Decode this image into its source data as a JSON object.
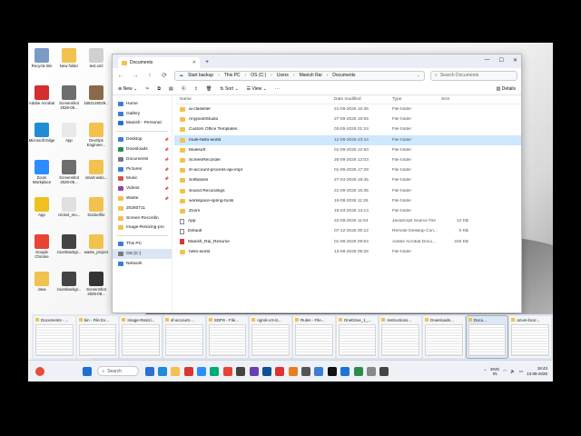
{
  "desktop": {
    "icons": [
      {
        "label": "Recycle Bin",
        "color": "#7b9bc6"
      },
      {
        "label": "New folder",
        "color": "#f2c14e"
      },
      {
        "label": "test.xml",
        "color": "#d0d0d0"
      },
      {
        "label": "Adobe Acrobat",
        "color": "#d32f2f"
      },
      {
        "label": "Screenshot 2026-05...",
        "color": "#6e6e6e"
      },
      {
        "label": "1652145029...",
        "color": "#8a6a4a"
      },
      {
        "label": "Microsoft Edge",
        "color": "#1f8dd6"
      },
      {
        "label": "App",
        "color": "#e9e9e9"
      },
      {
        "label": "DevOps Engineer...",
        "color": "#f2c14e"
      },
      {
        "label": "Zoom Workplace",
        "color": "#2d8cff"
      },
      {
        "label": "Screenshot 2026-05...",
        "color": "#6e6e6e"
      },
      {
        "label": "smart-watc...",
        "color": "#f2c14e"
      },
      {
        "label": "App",
        "color": "#f0c020"
      },
      {
        "label": "cricket_mo...",
        "color": "#e0e0e0"
      },
      {
        "label": "Dockerfile",
        "color": "#f2c14e"
      },
      {
        "label": "Google Chrome",
        "color": "#e84436"
      },
      {
        "label": "zoombackgr...",
        "color": "#444"
      },
      {
        "label": "waste_project",
        "color": "#f2c14e"
      },
      {
        "label": "Java",
        "color": "#f2c14e"
      },
      {
        "label": "zoombackgr...",
        "color": "#444"
      },
      {
        "label": "Screenshot 2026-08...",
        "color": "#333"
      }
    ]
  },
  "explorer": {
    "tab_title": "Documents",
    "breadcrumb": [
      "This PC",
      "OS (C:)",
      "Users",
      "Manish Rai",
      "Documents"
    ],
    "start_backup": "Start backup",
    "search_placeholder": "Search Documents",
    "toolbar": {
      "new": "New",
      "sort": "Sort",
      "view": "View",
      "details": "Details"
    },
    "sidebar": [
      {
        "label": "Home",
        "color": "#3b7fd3",
        "pin": false,
        "sel": false
      },
      {
        "label": "Gallery",
        "color": "#3b7fd3",
        "pin": false,
        "sel": false
      },
      {
        "label": "Manish - Personal",
        "color": "#1e73d6",
        "pin": false,
        "sel": false
      },
      {
        "divider": true
      },
      {
        "label": "Desktop",
        "color": "#3b7fd3",
        "pin": true,
        "sel": false
      },
      {
        "label": "Downloads",
        "color": "#2f8b4a",
        "pin": true,
        "sel": false
      },
      {
        "label": "Documents",
        "color": "#7a7a7a",
        "pin": true,
        "sel": false
      },
      {
        "label": "Pictures",
        "color": "#3b7fd3",
        "pin": true,
        "sel": false
      },
      {
        "label": "Music",
        "color": "#d9534f",
        "pin": true,
        "sel": false
      },
      {
        "label": "Videos",
        "color": "#8e44ad",
        "pin": true,
        "sel": false
      },
      {
        "label": "Waste",
        "color": "#f2c14e",
        "pin": true,
        "sel": false
      },
      {
        "label": "20260711",
        "color": "#f2c14e",
        "pin": false,
        "sel": false
      },
      {
        "label": "Screen Recordin",
        "color": "#f2c14e",
        "pin": false,
        "sel": false
      },
      {
        "label": "Image-Resizing-pro",
        "color": "#f2c14e",
        "pin": false,
        "sel": false
      },
      {
        "divider": true
      },
      {
        "label": "This PC",
        "color": "#3b7fd3",
        "pin": false,
        "sel": false
      },
      {
        "label": "OS (C:)",
        "color": "#7a7a7a",
        "pin": false,
        "sel": true
      },
      {
        "label": "Network",
        "color": "#3b7fd3",
        "pin": false,
        "sel": false
      }
    ],
    "columns": {
      "name": "Name",
      "date": "Date modified",
      "type": "Type",
      "size": "Size"
    },
    "files": [
      {
        "name": "ai-classifier",
        "date": "21-06-2026 16:36",
        "type": "File folder",
        "size": "",
        "kind": "folder"
      },
      {
        "name": "AnypointStudio",
        "date": "27-08-2026 19:55",
        "type": "File folder",
        "size": "",
        "kind": "folder"
      },
      {
        "name": "Custom Office Templates",
        "date": "03-05-2026 01:24",
        "type": "File folder",
        "size": "",
        "kind": "folder"
      },
      {
        "name": "mule-hello-world",
        "date": "12-08-2026 23:44",
        "type": "File folder",
        "size": "",
        "kind": "folder",
        "sel": true
      },
      {
        "name": "Mulesoft",
        "date": "01-09-2026 12:50",
        "type": "File folder",
        "size": "",
        "kind": "folder"
      },
      {
        "name": "ScreenRecorder",
        "date": "26-09-2026 13:03",
        "type": "File folder",
        "size": "",
        "kind": "folder"
      },
      {
        "name": "sf-account-process-api-impl",
        "date": "01-09-2026 17:28",
        "type": "File folder",
        "size": "",
        "kind": "folder"
      },
      {
        "name": "Softwares",
        "date": "27-04-2026 18:45",
        "type": "File folder",
        "size": "",
        "kind": "folder"
      },
      {
        "name": "Sound Recordings",
        "date": "21-09-2026 16:35",
        "type": "File folder",
        "size": "",
        "kind": "folder"
      },
      {
        "name": "workspace-spring-tools",
        "date": "16-08-2026 11:26",
        "type": "File folder",
        "size": "",
        "kind": "folder"
      },
      {
        "name": "Zoom",
        "date": "15-03-2026 13:14",
        "type": "File folder",
        "size": "",
        "kind": "folder"
      },
      {
        "name": "App",
        "date": "22-09-2026 11:54",
        "type": "JavaScript Source File",
        "size": "12 KB",
        "kind": "file"
      },
      {
        "name": "Default",
        "date": "07-12-2025 00:12",
        "type": "Remote Desktop Con...",
        "size": "0 KB",
        "kind": "file"
      },
      {
        "name": "Manish_Rai_Resume",
        "date": "01-06-2026 09:54",
        "type": "Adobe Acrobat Docu...",
        "size": "226 KB",
        "kind": "pdf"
      },
      {
        "name": "hello-world",
        "date": "13-08-2026 09:25",
        "type": "File folder",
        "size": "",
        "kind": "folder"
      }
    ]
  },
  "switcher": [
    {
      "label": "Documents - ...",
      "act": false
    },
    {
      "label": "bin - File Ex...",
      "act": false
    },
    {
      "label": "Image-Resizi...",
      "act": false
    },
    {
      "label": "sf-account-...",
      "act": false
    },
    {
      "label": "SDPS - File...",
      "act": false
    },
    {
      "label": "ngrok-v3-st...",
      "act": false
    },
    {
      "label": "Rules - File...",
      "act": false
    },
    {
      "label": "OneDrive_1_...",
      "act": false
    },
    {
      "label": "Instructions...",
      "act": false
    },
    {
      "label": "Downloads...",
      "act": false
    },
    {
      "label": "Docu...",
      "act": true
    },
    {
      "label": "azure-bcor...",
      "act": false
    }
  ],
  "taskbar": {
    "search_label": "Search",
    "apps": [
      "#2b6fd6",
      "#1f8dd6",
      "#f2c14e",
      "#d33",
      "#2d8cff",
      "#0a7",
      "#e84436",
      "#444",
      "#6a3fb5",
      "#0b5394",
      "#d33",
      "#e67e22",
      "#555",
      "#3b7fd3",
      "#111",
      "#1e73d6",
      "#2f8b4a",
      "#888",
      "#444"
    ],
    "lang": "ENG",
    "region": "IN",
    "time": "18:43",
    "date": "13-08-2026"
  }
}
